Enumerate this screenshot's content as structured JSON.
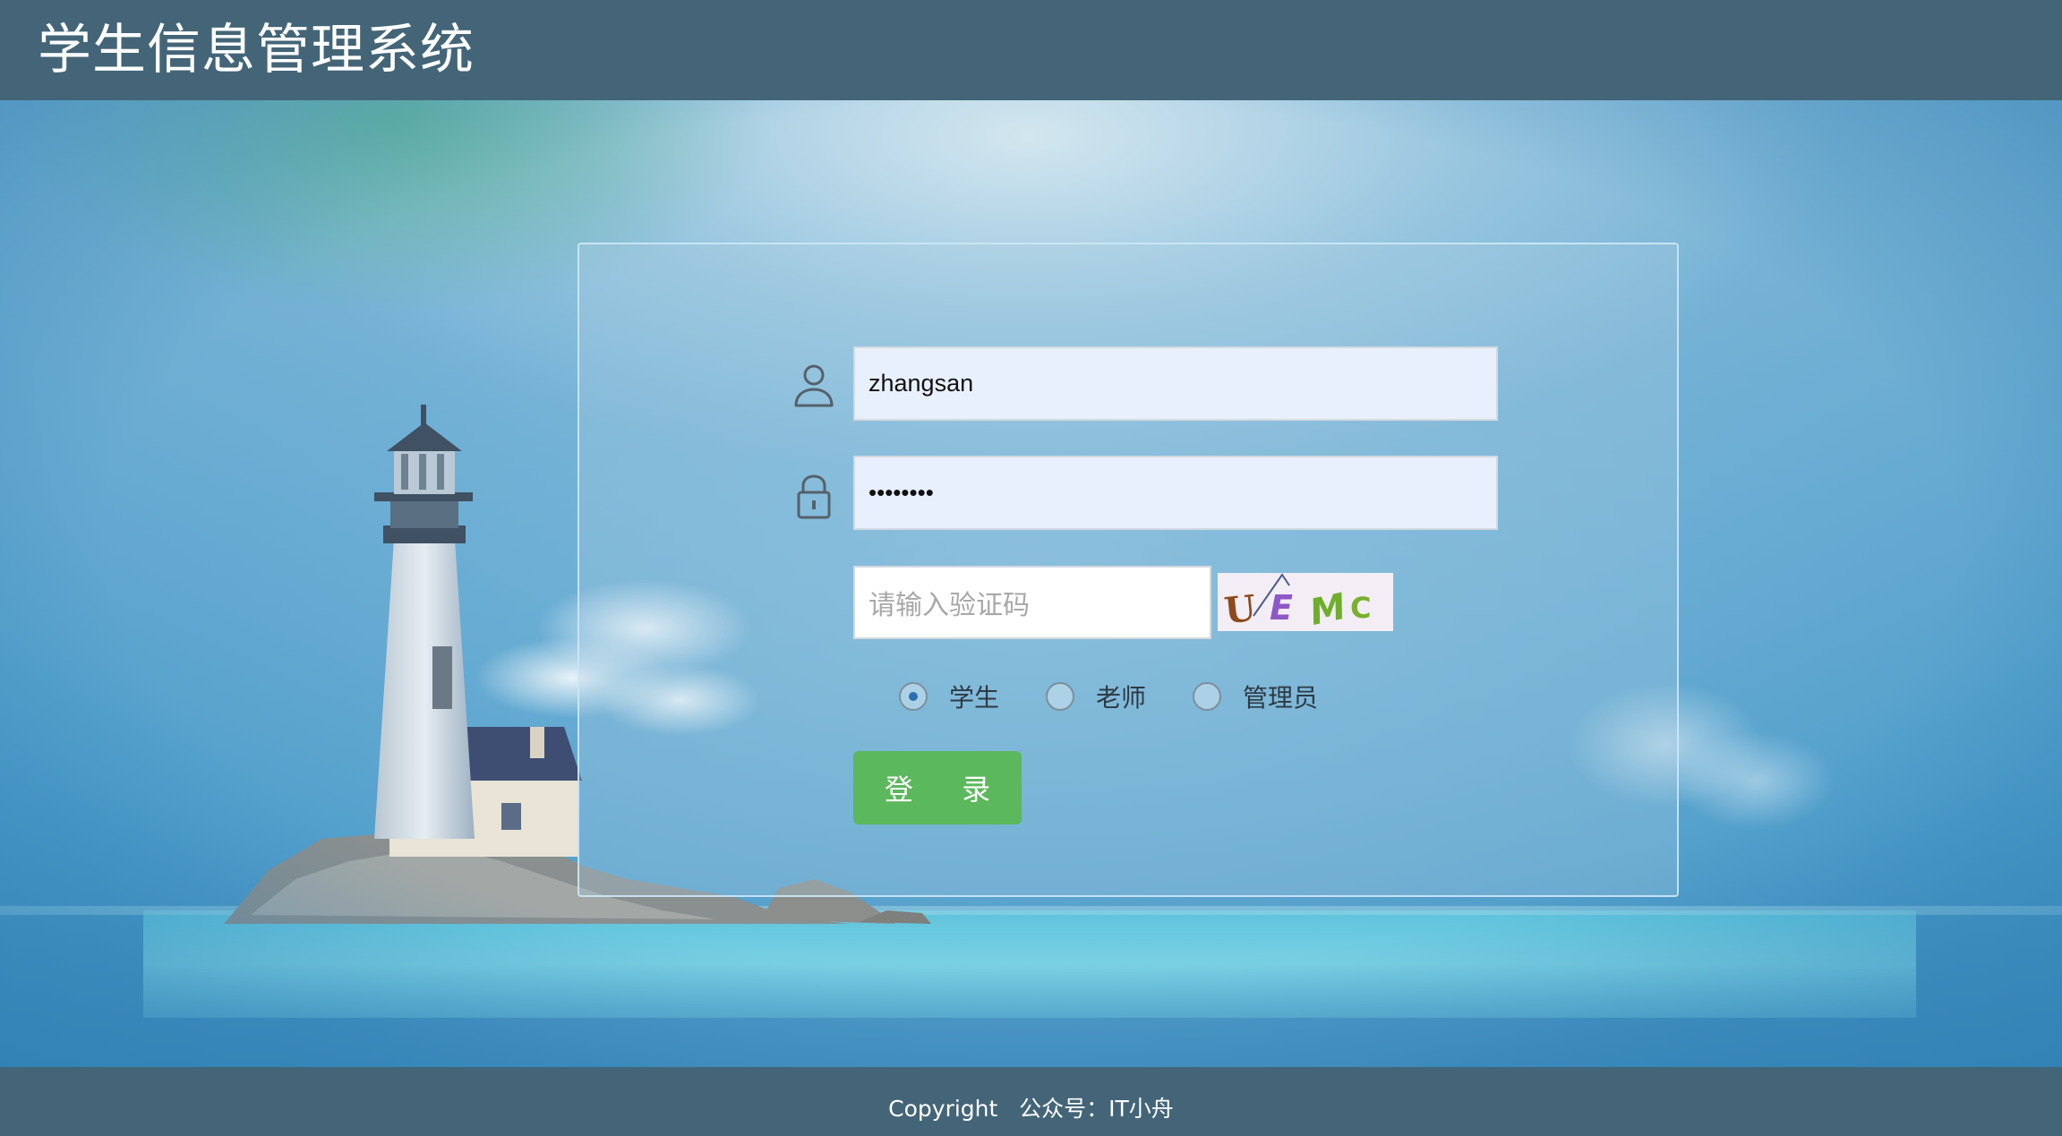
{
  "header": {
    "title": "学生信息管理系统"
  },
  "login_form": {
    "username": {
      "icon": "user-icon",
      "value": "zhangsan"
    },
    "password": {
      "icon": "lock-icon",
      "masked_value": "••••••••"
    },
    "captcha": {
      "placeholder": "请输入验证码",
      "image_text": "UEMC"
    },
    "roles": [
      {
        "label": "学生",
        "checked": true
      },
      {
        "label": "老师",
        "checked": false
      },
      {
        "label": "管理员",
        "checked": false
      }
    ],
    "submit_label": "登 录"
  },
  "footer": {
    "copyright": "Copyright   公众号：IT小舟"
  },
  "colors": {
    "header_bg": "#436577",
    "button_bg": "#5cb85c",
    "input_bg": "#e8f0fe",
    "radio_checked": "#2b6fb0"
  }
}
